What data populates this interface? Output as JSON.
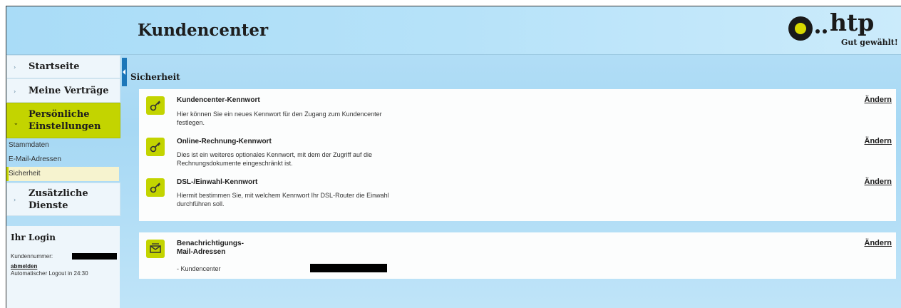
{
  "header": {
    "title": "Kundencenter",
    "logo_text": "htp",
    "logo_slogan": "Gut gewählt!"
  },
  "sidebar": {
    "items": [
      {
        "label": "Startseite"
      },
      {
        "label": "Meine Verträge"
      },
      {
        "label": "Persönliche Einstellungen",
        "line1": "Persönliche",
        "line2": "Einstellungen"
      },
      {
        "label": "Zusätzliche Dienste",
        "line1": "Zusätzliche",
        "line2": "Dienste"
      }
    ],
    "sub_items": [
      "Stammdaten",
      "E-Mail-Adressen",
      "Sicherheit"
    ],
    "selected_sub": "Sicherheit"
  },
  "login": {
    "heading": "Ihr Login",
    "customer_number_label": "Kundennummer:",
    "logout_link": "abmelden",
    "auto_logout": "Automatischer Logout in 24:30"
  },
  "main": {
    "section_title": "Sicherheit",
    "change_label": "Ändern",
    "security_rows": [
      {
        "title": "Kundencenter-Kennwort",
        "desc_line1": "Hier können Sie ein neues Kennwort für den Zugang zum Kundencenter",
        "desc_line2": "festlegen."
      },
      {
        "title": "Online-Rechnung-Kennwort",
        "desc_line1": "Dies ist ein weiteres optionales Kennwort, mit dem der Zugriff auf die",
        "desc_line2": "Rechnungsdokumente eingeschränkt ist."
      },
      {
        "title": "DSL-/Einwahl-Kennwort",
        "desc_line1": "Hiermit bestimmen Sie, mit welchem Kennwort Ihr DSL-Router die Einwahl",
        "desc_line2": "durchführen soll."
      }
    ],
    "notification": {
      "title_line1": "Benachrichtigungs-",
      "title_line2": "Mail-Adressen",
      "item": "- Kundencenter"
    }
  },
  "colors": {
    "accent_green": "#c3d400",
    "toggle_blue": "#1c77b9",
    "background_blue": "#a6d8f4"
  }
}
